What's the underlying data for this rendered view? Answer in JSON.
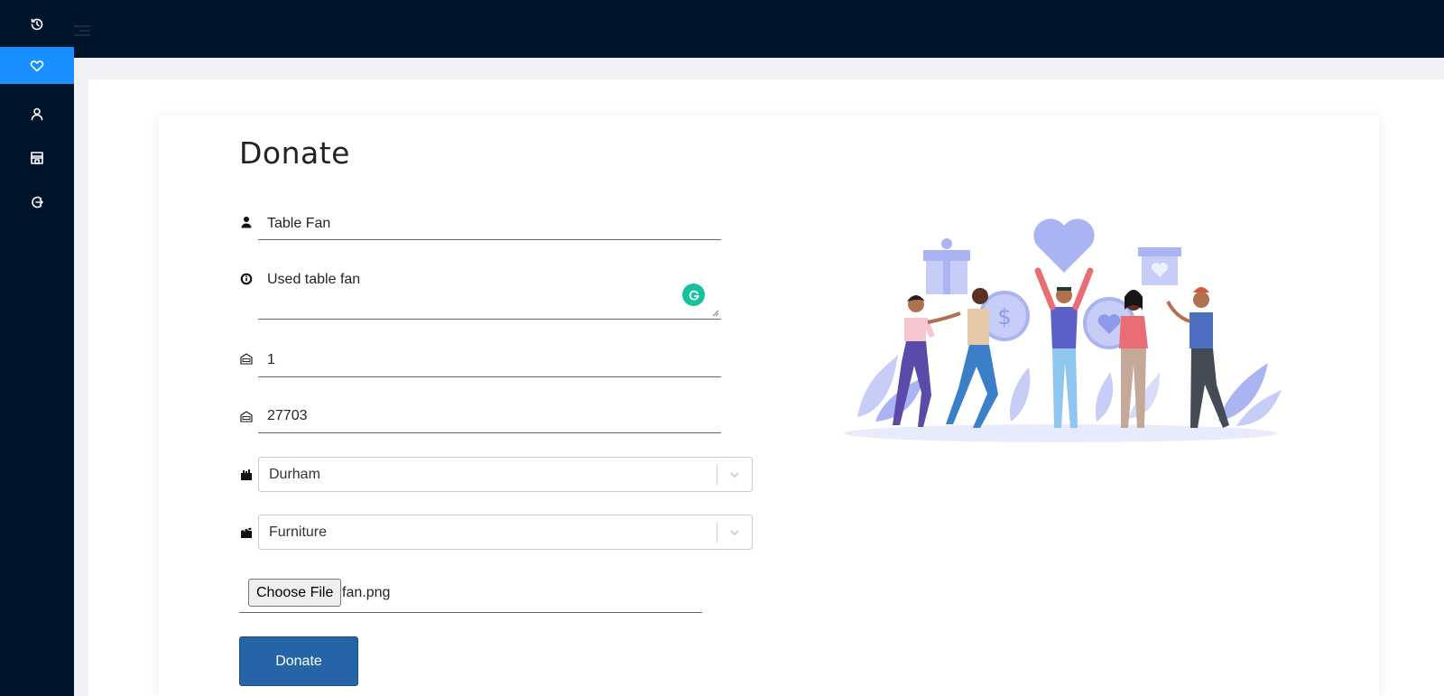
{
  "sidebar": {
    "items": [
      {
        "icon": "history-icon",
        "active": false
      },
      {
        "icon": "heart-icon",
        "active": true
      },
      {
        "icon": "user-icon",
        "active": false
      },
      {
        "icon": "store-icon",
        "active": false
      },
      {
        "icon": "logout-icon",
        "active": false
      }
    ],
    "active_color": "#1890ff",
    "bg_color": "#00152b"
  },
  "topbar": {
    "menu_icon": "menu-toggle-icon"
  },
  "form": {
    "title": "Donate",
    "item_name": "Table Fan",
    "description": "Used table fan",
    "quantity": "1",
    "zipcode": "27703",
    "city": "Durham",
    "category": "Furniture",
    "file_button_label": "Choose File",
    "file_name": "fan.png",
    "submit_label": "Donate",
    "submit_color": "#2564a6"
  }
}
